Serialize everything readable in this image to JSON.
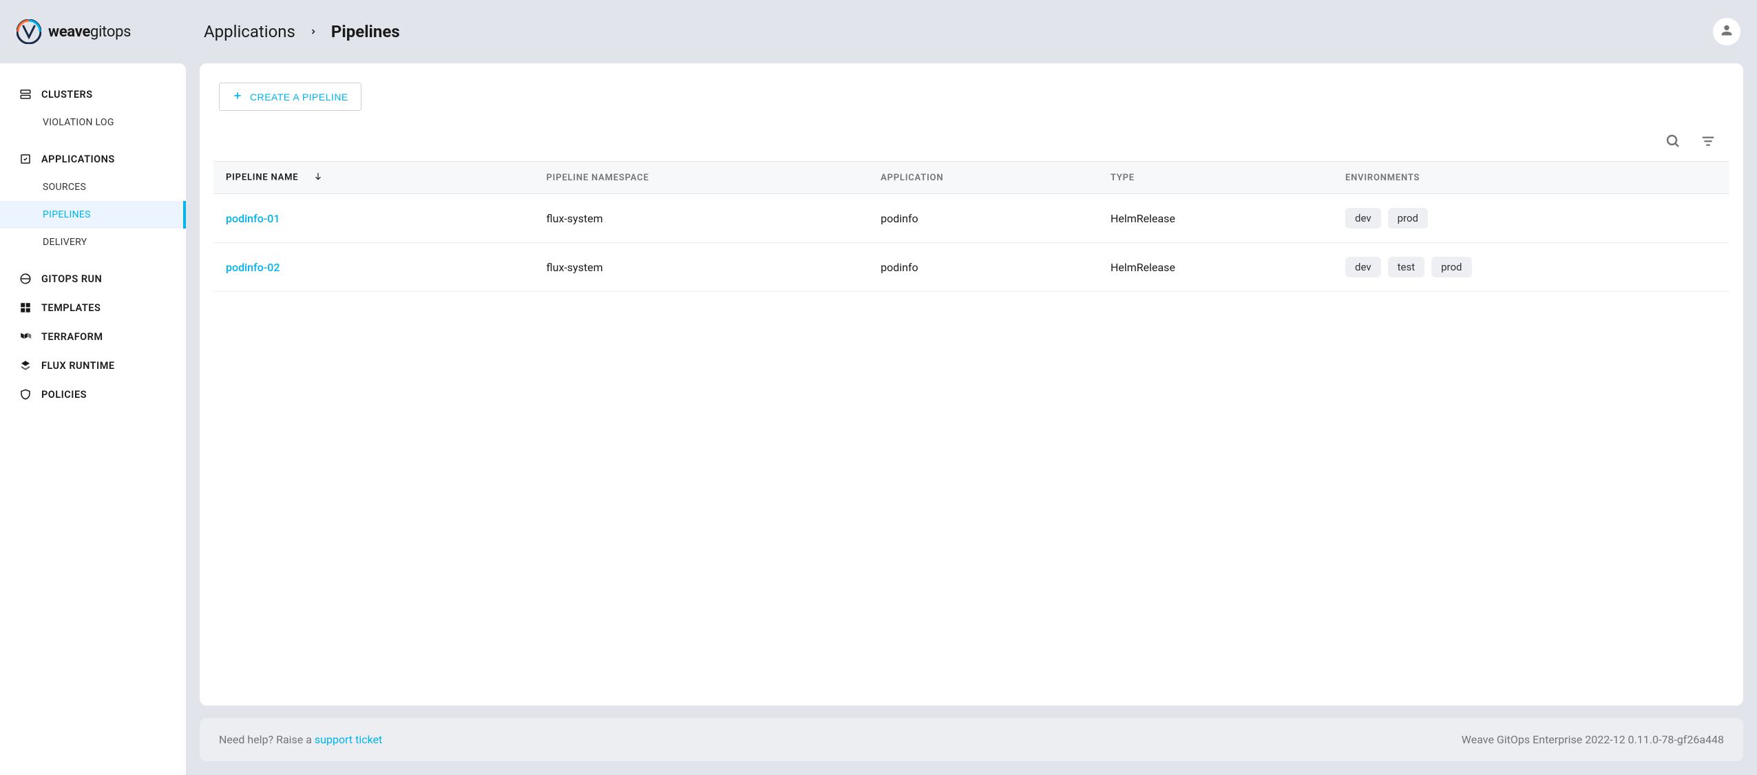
{
  "brand": {
    "name_bold": "weave",
    "name_light": "gitops"
  },
  "breadcrumb": {
    "root": "Applications",
    "current": "Pipelines"
  },
  "sidebar": {
    "clusters": {
      "label": "CLUSTERS",
      "items": [
        {
          "label": "VIOLATION LOG"
        }
      ]
    },
    "applications": {
      "label": "APPLICATIONS",
      "items": [
        {
          "label": "SOURCES"
        },
        {
          "label": "PIPELINES",
          "active": true
        },
        {
          "label": "DELIVERY"
        }
      ]
    },
    "gitops_run": {
      "label": "GITOPS RUN"
    },
    "templates": {
      "label": "TEMPLATES"
    },
    "terraform": {
      "label": "TERRAFORM"
    },
    "flux_runtime": {
      "label": "FLUX RUNTIME"
    },
    "policies": {
      "label": "POLICIES"
    }
  },
  "actions": {
    "create_pipeline": "CREATE A PIPELINE"
  },
  "table": {
    "headers": {
      "name": "PIPELINE NAME",
      "namespace": "PIPELINE NAMESPACE",
      "application": "APPLICATION",
      "type": "TYPE",
      "environments": "ENVIRONMENTS"
    },
    "rows": [
      {
        "name": "podinfo-01",
        "namespace": "flux-system",
        "application": "podinfo",
        "type": "HelmRelease",
        "environments": [
          "dev",
          "prod"
        ]
      },
      {
        "name": "podinfo-02",
        "namespace": "flux-system",
        "application": "podinfo",
        "type": "HelmRelease",
        "environments": [
          "dev",
          "test",
          "prod"
        ]
      }
    ]
  },
  "footer": {
    "help_prefix": "Need help? Raise a ",
    "help_link": "support ticket",
    "version": "Weave GitOps Enterprise 2022-12 0.11.0-78-gf26a448"
  }
}
